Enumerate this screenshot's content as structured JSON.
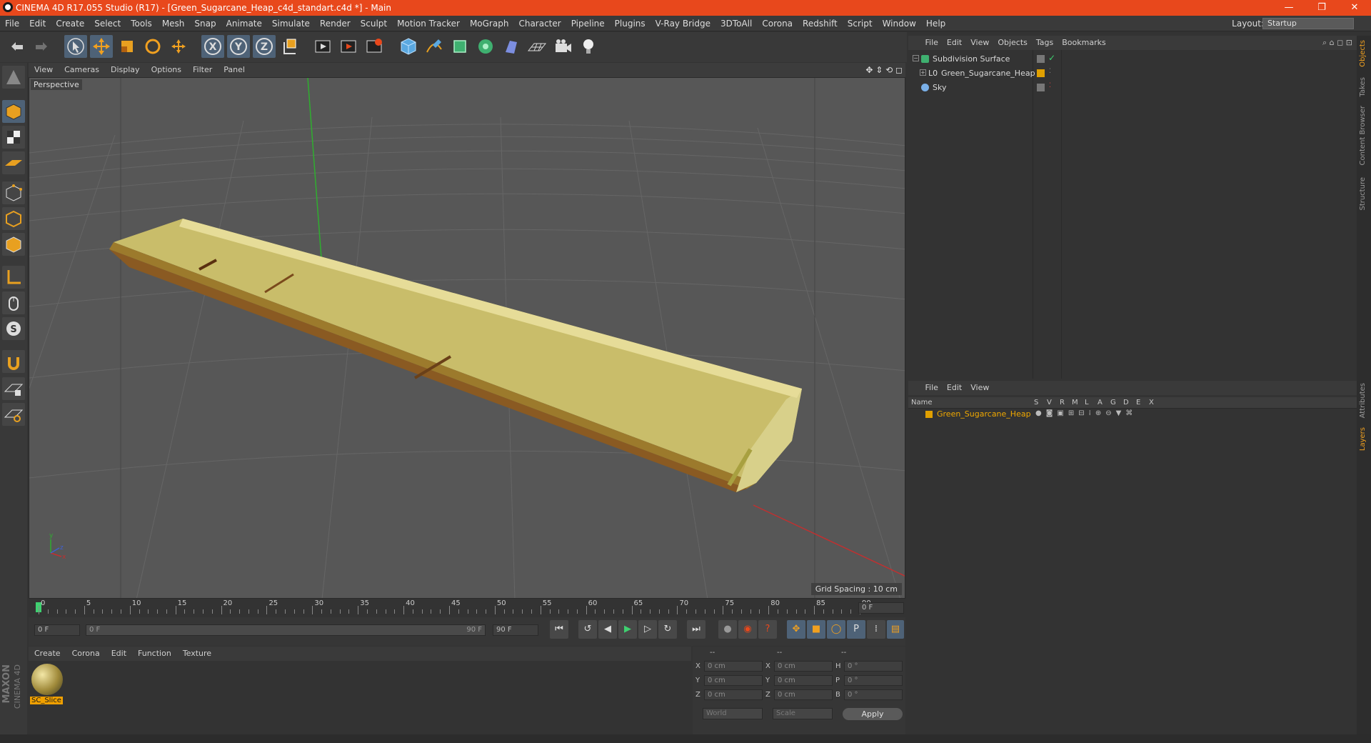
{
  "window": {
    "title": "CINEMA 4D R17.055 Studio (R17) - [Green_Sugarcane_Heap_c4d_standart.c4d *] - Main",
    "min": "—",
    "max": "❐",
    "close": "✕"
  },
  "menu": [
    "File",
    "Edit",
    "Create",
    "Select",
    "Tools",
    "Mesh",
    "Snap",
    "Animate",
    "Simulate",
    "Render",
    "Sculpt",
    "Motion Tracker",
    "MoGraph",
    "Character",
    "Pipeline",
    "Plugins",
    "V-Ray Bridge",
    "3DToAll",
    "Corona",
    "Redshift",
    "Script",
    "Window",
    "Help"
  ],
  "layout": {
    "label": "Layout:",
    "value": "Startup"
  },
  "viewport": {
    "menu": [
      "View",
      "Cameras",
      "Display",
      "Options",
      "Filter",
      "Panel"
    ],
    "label": "Perspective",
    "grid_spacing": "Grid Spacing : 10 cm"
  },
  "timeline": {
    "ticks": [
      "0",
      "5",
      "10",
      "15",
      "20",
      "25",
      "30",
      "35",
      "40",
      "45",
      "50",
      "55",
      "60",
      "65",
      "70",
      "75",
      "80",
      "85",
      "90"
    ],
    "current": "0 F",
    "start": "0 F",
    "range_start": "0 F",
    "range_end": "90 F",
    "end": "90 F"
  },
  "material_manager": {
    "menu": [
      "Create",
      "Corona",
      "Edit",
      "Function",
      "Texture"
    ],
    "material_name": "SC_Slice"
  },
  "coordinates": {
    "header": [
      "--",
      "--",
      "--"
    ],
    "rows": [
      {
        "a": "X",
        "a_val": "0 cm",
        "b": "X",
        "b_val": "0 cm",
        "c": "H",
        "c_val": "0 °"
      },
      {
        "a": "Y",
        "a_val": "0 cm",
        "b": "Y",
        "b_val": "0 cm",
        "c": "P",
        "c_val": "0 °"
      },
      {
        "a": "Z",
        "a_val": "0 cm",
        "b": "Z",
        "b_val": "0 cm",
        "c": "B",
        "c_val": "0 °"
      }
    ],
    "world": "World",
    "scale": "Scale",
    "apply": "Apply"
  },
  "object_manager": {
    "menu": [
      "File",
      "Edit",
      "View",
      "Objects",
      "Tags",
      "Bookmarks"
    ],
    "objects": [
      {
        "name": "Subdivision Surface"
      },
      {
        "name": "Green_Sugarcane_Heap"
      },
      {
        "name": "Sky"
      }
    ]
  },
  "layer_manager": {
    "menu": [
      "File",
      "Edit",
      "View"
    ],
    "columns": [
      "Name",
      "S",
      "V",
      "R",
      "M",
      "L",
      "A",
      "G",
      "D",
      "E",
      "X"
    ],
    "layers": [
      {
        "name": "Green_Sugarcane_Heap",
        "color": "#e0a000"
      }
    ]
  },
  "side_tabs": [
    "Objects",
    "Takes",
    "Content Browser",
    "Structure",
    "Attributes",
    "Layers"
  ],
  "brand": {
    "line1": "MAXON",
    "line2": "CINEMA 4D"
  },
  "colors": {
    "titlebar": "#e8481c",
    "selected_tool": "#4e6277",
    "layer_color": "#e0a000"
  }
}
